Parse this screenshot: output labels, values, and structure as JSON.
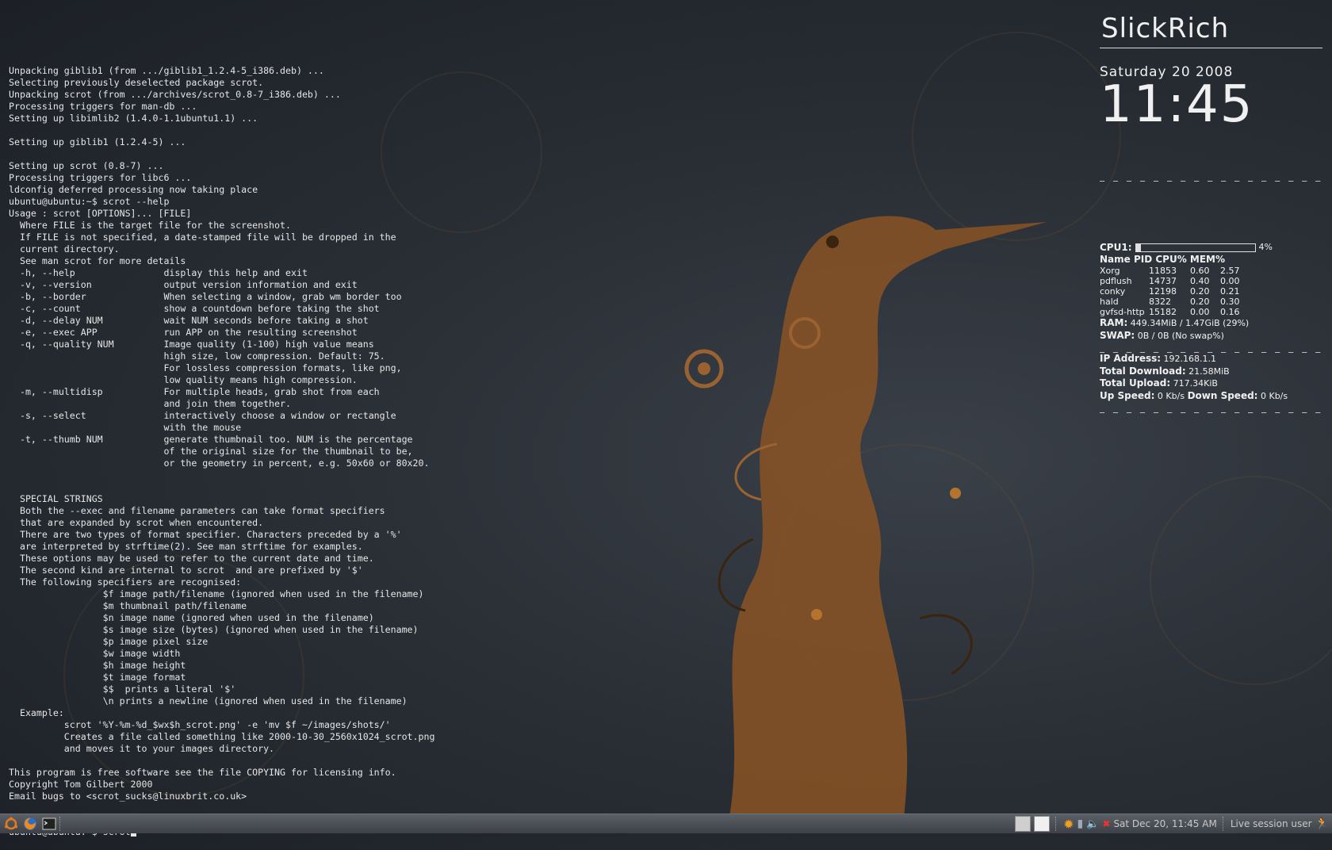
{
  "terminal": {
    "lines": [
      "Unpacking giblib1 (from .../giblib1_1.2.4-5_i386.deb) ...",
      "Selecting previously deselected package scrot.",
      "Unpacking scrot (from .../archives/scrot_0.8-7_i386.deb) ...",
      "Processing triggers for man-db ...",
      "Setting up libimlib2 (1.4.0-1.1ubuntu1.1) ...",
      "",
      "Setting up giblib1 (1.2.4-5) ...",
      "",
      "Setting up scrot (0.8-7) ...",
      "Processing triggers for libc6 ...",
      "ldconfig deferred processing now taking place",
      "ubuntu@ubuntu:~$ scrot --help",
      "Usage : scrot [OPTIONS]... [FILE]",
      "  Where FILE is the target file for the screenshot.",
      "  If FILE is not specified, a date-stamped file will be dropped in the",
      "  current directory.",
      "  See man scrot for more details",
      "  -h, --help                display this help and exit",
      "  -v, --version             output version information and exit",
      "  -b, --border              When selecting a window, grab wm border too",
      "  -c, --count               show a countdown before taking the shot",
      "  -d, --delay NUM           wait NUM seconds before taking a shot",
      "  -e, --exec APP            run APP on the resulting screenshot",
      "  -q, --quality NUM         Image quality (1-100) high value means",
      "                            high size, low compression. Default: 75.",
      "                            For lossless compression formats, like png,",
      "                            low quality means high compression.",
      "  -m, --multidisp           For multiple heads, grab shot from each",
      "                            and join them together.",
      "  -s, --select              interactively choose a window or rectangle",
      "                            with the mouse",
      "  -t, --thumb NUM           generate thumbnail too. NUM is the percentage",
      "                            of the original size for the thumbnail to be,",
      "                            or the geometry in percent, e.g. 50x60 or 80x20.",
      "",
      "",
      "  SPECIAL STRINGS",
      "  Both the --exec and filename parameters can take format specifiers",
      "  that are expanded by scrot when encountered.",
      "  There are two types of format specifier. Characters preceded by a '%'",
      "  are interpreted by strftime(2). See man strftime for examples.",
      "  These options may be used to refer to the current date and time.",
      "  The second kind are internal to scrot  and are prefixed by '$'",
      "  The following specifiers are recognised:",
      "                 $f image path/filename (ignored when used in the filename)",
      "                 $m thumbnail path/filename",
      "                 $n image name (ignored when used in the filename)",
      "                 $s image size (bytes) (ignored when used in the filename)",
      "                 $p image pixel size",
      "                 $w image width",
      "                 $h image height",
      "                 $t image format",
      "                 $$  prints a literal '$'",
      "                 \\n prints a newline (ignored when used in the filename)",
      "  Example:",
      "          scrot '%Y-%m-%d_$wx$h_scrot.png' -e 'mv $f ~/images/shots/'",
      "          Creates a file called something like 2000-10-30_2560x1024_scrot.png",
      "          and moves it to your images directory.",
      "",
      "This program is free software see the file COPYING for licensing info.",
      "Copyright Tom Gilbert 2000",
      "Email bugs to <scrot_sucks@linuxbrit.co.uk>"
    ],
    "prompt": "ubuntu@ubuntu:~$ scrot"
  },
  "conky": {
    "brand": "SlickRich",
    "date": "Saturday 20 2008",
    "time": "11:45",
    "dashes": "_ _ _ _ _ _ _ _ _ _ _ _ _ _ _ _ _ _ _ _ _ _ _ _ _ _ _ _ _ _",
    "cpu": {
      "label": "CPU1:",
      "percent_text": "4%",
      "fraction": 0.04
    },
    "proc_header": "Name PID CPU% MEM%",
    "processes": [
      {
        "name": "Xorg",
        "pid": "11853",
        "cpu": "0.60",
        "mem": "2.57"
      },
      {
        "name": "pdflush",
        "pid": "14737",
        "cpu": "0.40",
        "mem": "0.00"
      },
      {
        "name": "conky",
        "pid": "12198",
        "cpu": "0.20",
        "mem": "0.21"
      },
      {
        "name": "hald",
        "pid": "8322",
        "cpu": "0.20",
        "mem": "0.30"
      },
      {
        "name": "gvfsd-http",
        "pid": "15182",
        "cpu": "0.00",
        "mem": "0.16"
      }
    ],
    "ram_label": "RAM:",
    "ram_value": "449.34MiB / 1.47GiB (29%)",
    "swap_label": "SWAP:",
    "swap_value": "0B / 0B (No swap%)",
    "ip_label": "IP Address:",
    "ip_value": "192.168.1.1",
    "down_label": "Total Download:",
    "down_value": "21.58MiB",
    "up_label": "Total Upload:",
    "up_value": "717.34KiB",
    "upspeed_label": "Up Speed:",
    "upspeed_value": "0 Kb/s",
    "downspeed_label": "Down Speed:",
    "downspeed_value": "0 Kb/s"
  },
  "taskbar": {
    "clock": "Sat Dec 20, 11:45 AM",
    "session": "Live session user",
    "icons": [
      "ubuntu-menu-icon",
      "firefox-icon",
      "terminal-icon"
    ]
  }
}
